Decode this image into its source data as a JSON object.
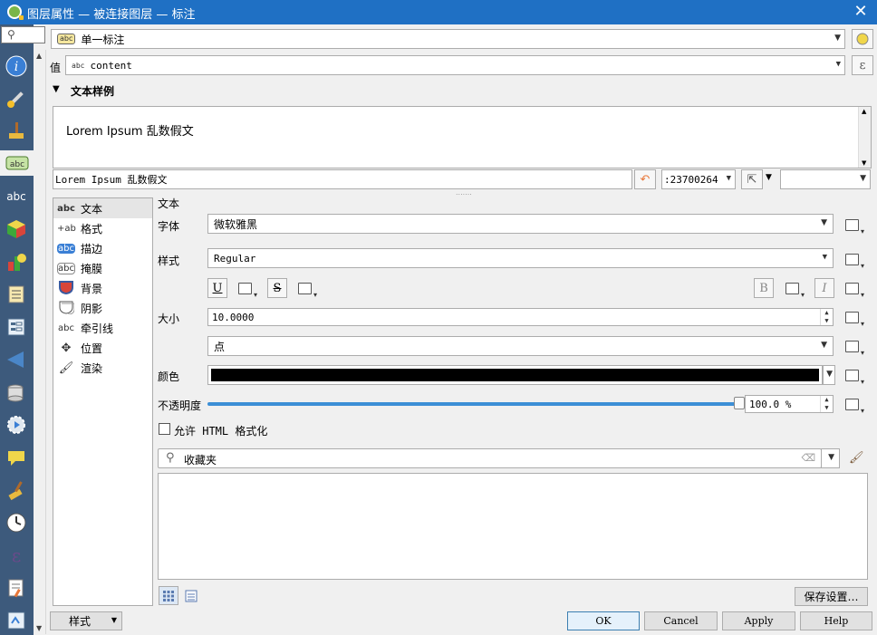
{
  "window": {
    "title": "图层属性 — 被连接图层 — 标注"
  },
  "sidebar": {
    "search_icon": "search-icon",
    "items": [
      {
        "name": "information",
        "icon": "info-icon"
      },
      {
        "name": "source",
        "icon": "wrench-icon"
      },
      {
        "name": "symbology",
        "icon": "paintbrush-icon"
      },
      {
        "name": "labels",
        "icon": "abc-label-icon",
        "active": true
      },
      {
        "name": "masks",
        "icon": "abc-mask-icon"
      },
      {
        "name": "3d-view",
        "icon": "cube-icon"
      },
      {
        "name": "diagrams",
        "icon": "diagram-icon"
      },
      {
        "name": "fields",
        "icon": "fields-icon"
      },
      {
        "name": "attributes-form",
        "icon": "form-icon"
      },
      {
        "name": "joins",
        "icon": "join-icon"
      },
      {
        "name": "auxiliary-storage",
        "icon": "database-icon"
      },
      {
        "name": "actions",
        "icon": "action-gear-icon"
      },
      {
        "name": "display",
        "icon": "speech-bubble-icon"
      },
      {
        "name": "rendering",
        "icon": "brush-icon"
      },
      {
        "name": "temporal",
        "icon": "clock-icon"
      },
      {
        "name": "variables",
        "icon": "epsilon-icon"
      },
      {
        "name": "metadata",
        "icon": "metadata-icon"
      },
      {
        "name": "dependencies",
        "icon": "dependencies-icon"
      }
    ]
  },
  "mode": {
    "value": "单一标注"
  },
  "value_row": {
    "label": "值",
    "field": "content",
    "badge": "abc"
  },
  "sample_section": {
    "title": "文本样例",
    "preview_text": "Lorem Ipsum 乱数假文",
    "input_text": "Lorem Ipsum 乱数假文",
    "scale": ":23700264"
  },
  "tabs": [
    {
      "label": "文本",
      "icon": "abc",
      "selected": true
    },
    {
      "label": "格式",
      "icon": "+ab"
    },
    {
      "label": "描边",
      "icon": "abc"
    },
    {
      "label": "掩膜",
      "icon": "abc"
    },
    {
      "label": "背景",
      "icon": "shield"
    },
    {
      "label": "阴影",
      "icon": "shadow"
    },
    {
      "label": "牵引线",
      "icon": "abc"
    },
    {
      "label": "位置",
      "icon": "pos"
    },
    {
      "label": "渲染",
      "icon": "brush"
    }
  ],
  "text_panel": {
    "heading": "文本",
    "font_label": "字体",
    "font_value": "微软雅黑",
    "style_label": "样式",
    "style_value": "Regular",
    "underline": "U",
    "strike": "S",
    "bold": "B",
    "italic": "I",
    "size_label": "大小",
    "size_value": "10.0000",
    "unit_value": "点",
    "color_label": "颜色",
    "color_value": "#000000",
    "opacity_label": "不透明度",
    "opacity_value": "100.0 %",
    "opacity_fraction": 1.0,
    "html_label": "允许 HTML 格式化"
  },
  "favorites": {
    "search_value": "收藏夹"
  },
  "footer": {
    "style_button": "样式",
    "save_settings": "保存设置…",
    "ok": "OK",
    "cancel": "Cancel",
    "apply": "Apply",
    "help": "Help"
  }
}
